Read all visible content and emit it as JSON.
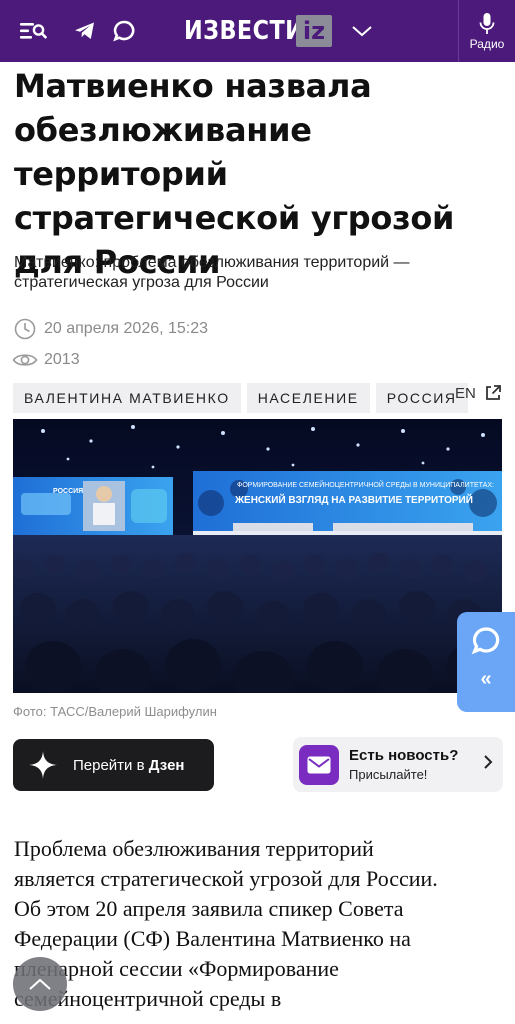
{
  "header": {
    "logo_text": "ИЗВЕСТИЯ",
    "logo_badge": "iz",
    "radio_label": "Радио",
    "background_color": "#4b1a7a",
    "icons": [
      "menu-search-icon",
      "telegram-icon",
      "chat-icon",
      "chevron-down-icon",
      "microphone-icon"
    ]
  },
  "article": {
    "title": "Матвиенко назвала обезлюживание территорий стратегической угрозой для России",
    "subtitle": "Матвиенко: проблема обезлюживания территорий — стратегическая угроза для России",
    "date": "20 апреля 2026, 15:23",
    "views": "2013",
    "tags": [
      "ВАЛЕНТИНА МАТВИЕНКО",
      "НАСЕЛЕНИЕ",
      "РОССИЯ"
    ],
    "en_link": "EN",
    "photo_caption": "Фото: ТАСС/Валерий Шарифулин",
    "photo_screen_text": {
      "line1": "ФОРМИРОВАНИЕ СЕМЕЙНОЦЕНТРИЧНОЙ СРЕДЫ В МУНИЦИПАЛИТЕТАХ:",
      "line2": "ЖЕНСКИЙ ВЗГЛЯД НА РАЗВИТИЕ ТЕРРИТОРИЙ",
      "left_logo": "РОССИЯ"
    },
    "body_lines": [
      "Проблема обезлюживания территорий",
      "является стратегической угрозой для России.",
      "Об этом 20 апреля заявила спикер Совета",
      "Федерации (СФ) Валентина Матвиенко на",
      "пленарной сессии «Формирование",
      "семейноцентричной среды в"
    ]
  },
  "actions": {
    "dzen_prefix": "Перейти в ",
    "dzen_bold": "Дзен",
    "news_title": "Есть новость?",
    "news_sub": "Присылайте!"
  },
  "side_widget": {
    "arrow": "«",
    "color": "#6aa6f5"
  }
}
